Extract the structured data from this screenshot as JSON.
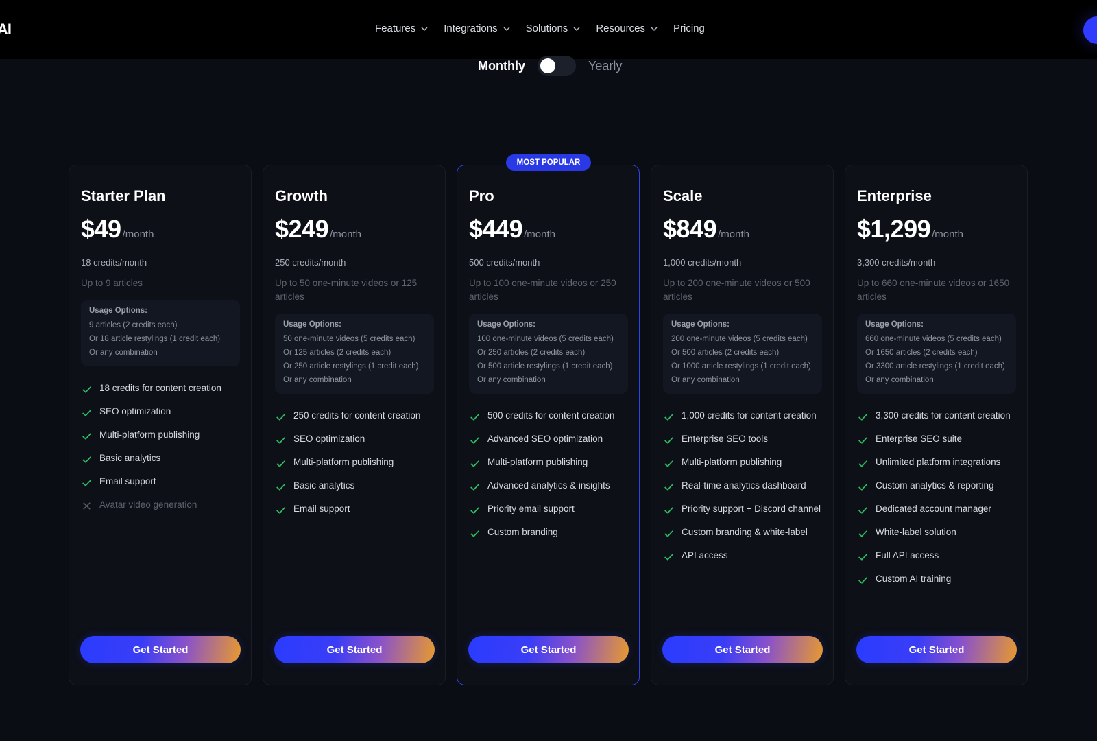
{
  "brand": {
    "logo_text": "AI"
  },
  "nav": {
    "items": [
      {
        "label": "Features",
        "has_dropdown": true
      },
      {
        "label": "Integrations",
        "has_dropdown": true
      },
      {
        "label": "Solutions",
        "has_dropdown": true
      },
      {
        "label": "Resources",
        "has_dropdown": true
      },
      {
        "label": "Pricing",
        "has_dropdown": false
      }
    ]
  },
  "billing": {
    "monthly_label": "Monthly",
    "yearly_label": "Yearly",
    "selected": "Monthly"
  },
  "colors": {
    "accent": "#2a39e6",
    "check": "#2fbf63",
    "background": "#0a0d14"
  },
  "plans": [
    {
      "name": "Starter Plan",
      "price": "$49",
      "period": "/month",
      "credits": "18 credits/month",
      "up_to": "Up to 9 articles",
      "usage_title": "Usage Options:",
      "usage": [
        "9 articles (2 credits each)",
        "Or 18 article restylings (1 credit each)",
        "Or any combination"
      ],
      "features": [
        {
          "text": "18 credits for content creation",
          "included": true
        },
        {
          "text": "SEO optimization",
          "included": true
        },
        {
          "text": "Multi-platform publishing",
          "included": true
        },
        {
          "text": "Basic analytics",
          "included": true
        },
        {
          "text": "Email support",
          "included": true
        },
        {
          "text": "Avatar video generation",
          "included": false
        }
      ],
      "cta": "Get Started"
    },
    {
      "name": "Growth",
      "price": "$249",
      "period": "/month",
      "credits": "250 credits/month",
      "up_to": "Up to 50 one-minute videos or 125 articles",
      "usage_title": "Usage Options:",
      "usage": [
        "50 one-minute videos (5 credits each)",
        "Or 125 articles (2 credits each)",
        "Or 250 article restylings (1 credit each)",
        "Or any combination"
      ],
      "features": [
        {
          "text": "250 credits for content creation",
          "included": true
        },
        {
          "text": "SEO optimization",
          "included": true
        },
        {
          "text": "Multi-platform publishing",
          "included": true
        },
        {
          "text": "Basic analytics",
          "included": true
        },
        {
          "text": "Email support",
          "included": true
        }
      ],
      "cta": "Get Started"
    },
    {
      "name": "Pro",
      "price": "$449",
      "period": "/month",
      "badge": "MOST POPULAR",
      "credits": "500 credits/month",
      "up_to": "Up to 100 one-minute videos or 250 articles",
      "usage_title": "Usage Options:",
      "usage": [
        "100 one-minute videos (5 credits each)",
        "Or 250 articles (2 credits each)",
        "Or 500 article restylings (1 credit each)",
        "Or any combination"
      ],
      "features": [
        {
          "text": "500 credits for content creation",
          "included": true
        },
        {
          "text": "Advanced SEO optimization",
          "included": true
        },
        {
          "text": "Multi-platform publishing",
          "included": true
        },
        {
          "text": "Advanced analytics & insights",
          "included": true
        },
        {
          "text": "Priority email support",
          "included": true
        },
        {
          "text": "Custom branding",
          "included": true
        }
      ],
      "cta": "Get Started"
    },
    {
      "name": "Scale",
      "price": "$849",
      "period": "/month",
      "credits": "1,000 credits/month",
      "up_to": "Up to 200 one-minute videos or 500 articles",
      "usage_title": "Usage Options:",
      "usage": [
        "200 one-minute videos (5 credits each)",
        "Or 500 articles (2 credits each)",
        "Or 1000 article restylings (1 credit each)",
        "Or any combination"
      ],
      "features": [
        {
          "text": "1,000 credits for content creation",
          "included": true
        },
        {
          "text": "Enterprise SEO tools",
          "included": true
        },
        {
          "text": "Multi-platform publishing",
          "included": true
        },
        {
          "text": "Real-time analytics dashboard",
          "included": true
        },
        {
          "text": "Priority support + Discord channel",
          "included": true
        },
        {
          "text": "Custom branding & white-label",
          "included": true
        },
        {
          "text": "API access",
          "included": true
        }
      ],
      "cta": "Get Started"
    },
    {
      "name": "Enterprise",
      "price": "$1,299",
      "period": "/month",
      "credits": "3,300 credits/month",
      "up_to": "Up to 660 one-minute videos or 1650 articles",
      "usage_title": "Usage Options:",
      "usage": [
        "660 one-minute videos (5 credits each)",
        "Or 1650 articles (2 credits each)",
        "Or 3300 article restylings (1 credit each)",
        "Or any combination"
      ],
      "features": [
        {
          "text": "3,300 credits for content creation",
          "included": true
        },
        {
          "text": "Enterprise SEO suite",
          "included": true
        },
        {
          "text": "Unlimited platform integrations",
          "included": true
        },
        {
          "text": "Custom analytics & reporting",
          "included": true
        },
        {
          "text": "Dedicated account manager",
          "included": true
        },
        {
          "text": "White-label solution",
          "included": true
        },
        {
          "text": "Full API access",
          "included": true
        },
        {
          "text": "Custom AI training",
          "included": true
        }
      ],
      "cta": "Get Started"
    }
  ]
}
